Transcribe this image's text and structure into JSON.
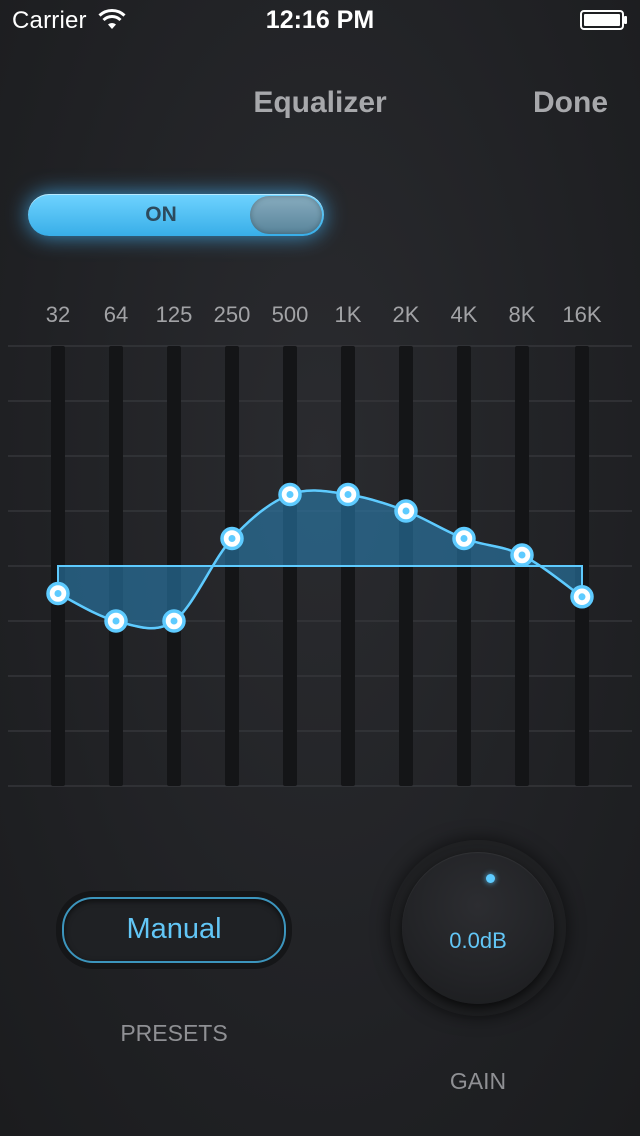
{
  "status_bar": {
    "carrier": "Carrier",
    "time": "12:16 PM",
    "wifi_icon": "wifi-icon",
    "battery_icon": "battery-full-icon"
  },
  "nav": {
    "title": "Equalizer",
    "done_label": "Done"
  },
  "toggle": {
    "label": "ON",
    "state": true
  },
  "equalizer": {
    "bands": [
      "32",
      "64",
      "125",
      "250",
      "500",
      "1K",
      "2K",
      "4K",
      "8K",
      "16K"
    ],
    "levels": [
      -0.25,
      -0.5,
      -0.5,
      0.25,
      0.65,
      0.65,
      0.5,
      0.25,
      0.1,
      -0.28
    ],
    "accent_color": "#5ecbff",
    "fill_color": "#2a86bd"
  },
  "presets": {
    "selected": "Manual",
    "caption": "PRESETS"
  },
  "gain": {
    "value": "0.0dB",
    "caption": "GAIN"
  }
}
